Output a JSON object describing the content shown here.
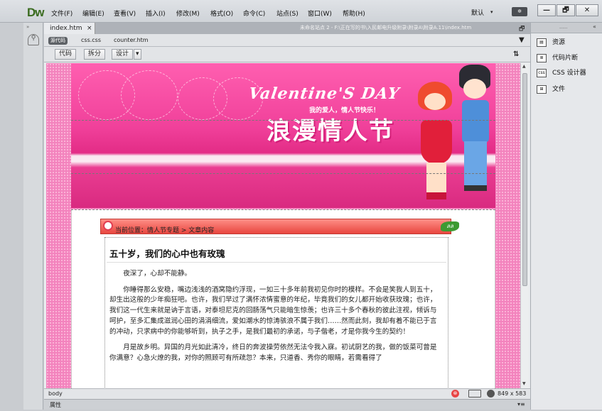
{
  "app": {
    "logo": "Dw"
  },
  "menu": [
    "文件(F)",
    "编辑(E)",
    "查看(V)",
    "插入(I)",
    "修改(M)",
    "格式(O)",
    "命令(C)",
    "站点(S)",
    "窗口(W)",
    "帮助(H)"
  ],
  "workspace": {
    "label": "默认",
    "gear_label": "✲"
  },
  "window_controls": {
    "minimize": "—",
    "restore": "🗗",
    "close": "✕"
  },
  "document": {
    "tab_label": "index.htm",
    "tab_close": "×",
    "path": "未命名站点 2 - F:\\正在写的书\\入民邮电升级附录\\附录A\\附录A.11\\index.htm",
    "related": {
      "source_code": "源代码",
      "files": [
        "css.css",
        "counter.htm"
      ]
    },
    "views": [
      "代码",
      "拆分",
      "设计"
    ]
  },
  "page": {
    "banner": {
      "title": "Valentine'S DAY",
      "subtitle": "我的爱人，情人节快乐！",
      "big_title": "浪漫情人节"
    },
    "location": {
      "text": "当前位置：情人节专题 > 文章内容",
      "deco": "ลล"
    },
    "article": {
      "title": "五十岁，我们的心中也有玫瑰",
      "paragraphs": [
        "夜深了，心却不能静。",
        "你睡得那么安稳，嘴边浅浅的酒窝隐约浮现，一如三十多年前我初见你时的模样。不会是笑我人到五十，却生出这般的少年痴狂吧。也许，我们早过了满怀浓情蜜意的年纪，毕竟我们的女儿都开始收获玫瑰；也许，我们这一代生来就是讷于言语，对泰坦尼克的回肠荡气只能暗生惊羡；也许三十多个春秋的彼此注视，倾诉与呵护，至多汇集成滋润心田的涓涓细流，爱如潮水的惊涛骇浪不属于我们……然而此刻，我却有着不能已于言的冲动，只求病中的你能够听到，执子之手，是我们最初的承诺，与子偕老，才是你我今生的契约！",
        "月是故乡明。异国的月光如此清冷，终日的奔波操劳依然无法令我入寐。初试厨艺的我，做的饭菜可曾是你满意？心急火燎的我，对你的照顾可有所疏忽？本来，只道香、秀你的眼睛，若需看得了"
      ]
    }
  },
  "status": {
    "tag": "body",
    "stop": "⊗",
    "size": "849 x 583 ⌄"
  },
  "properties": {
    "label": "属性",
    "menu": "▾≡"
  },
  "right_panel": {
    "handle": "······",
    "collapse": "«",
    "items": [
      {
        "label": "资源",
        "icon": "assets-icon"
      },
      {
        "label": "代码片断",
        "icon": "snippets-icon"
      },
      {
        "label": "CSS 设计器",
        "icon": "css-designer-icon"
      },
      {
        "label": "文件",
        "icon": "files-icon"
      }
    ]
  }
}
